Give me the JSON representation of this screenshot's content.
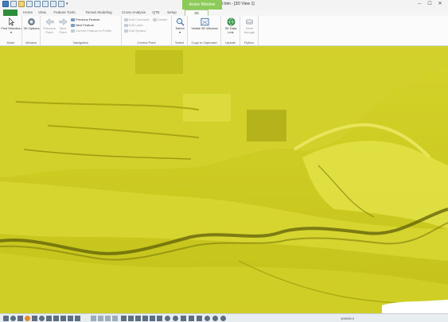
{
  "window": {
    "title": "Terrain - Mike3D.trim - [3D View 1]",
    "contextual_tab_group": "Active Window",
    "controls": {
      "minimize": "–",
      "maximize": "☐",
      "close": "✕"
    },
    "quick_access_extra": "▾"
  },
  "tabs": [
    {
      "label": "Home"
    },
    {
      "label": "View"
    },
    {
      "label": "Feature Tools"
    },
    {
      "label": "Terrain Modeling"
    },
    {
      "label": "Cross-Analysis"
    },
    {
      "label": "QTE"
    },
    {
      "label": "Setup"
    },
    {
      "label": "3D"
    }
  ],
  "ribbon": {
    "mode": {
      "find_selection": "Find Selection ▾",
      "group": "Mode"
    },
    "window": {
      "options_3d": "3D Options",
      "group": "Window"
    },
    "navigation": {
      "previous_point": "Previous Point",
      "next_point": "Next Point",
      "previous_feature": "Previous Feature",
      "next_feature": "Next Feature",
      "current_feature": "Current Feature to Profile",
      "group": "Navigation"
    },
    "control_point": {
      "edit_comment": "Edit Comment",
      "edit_label": "Edit Label",
      "edit_symbol": "Edit Symbol",
      "details": "Details",
      "group": "Control Point"
    },
    "select": {
      "select": "Select",
      "caret": "▾",
      "group": "Select"
    },
    "copy": {
      "visible_3d_window": "Visible 3D Window",
      "group": "Copy to Clipboard"
    },
    "update": {
      "google_earth": "3D Data Link",
      "group": "Update"
    },
    "flythru": {
      "drive_through": "Drive through",
      "group": "Flythru"
    }
  },
  "status": {
    "coordinates": "400000.0"
  },
  "colors": {
    "terrain": "#c9c81c",
    "terrain_light": "#e2e23e",
    "terrain_dark": "#6b6a10",
    "ribbon_accent": "#2f8c3d",
    "context_tab": "#8ccb59"
  }
}
